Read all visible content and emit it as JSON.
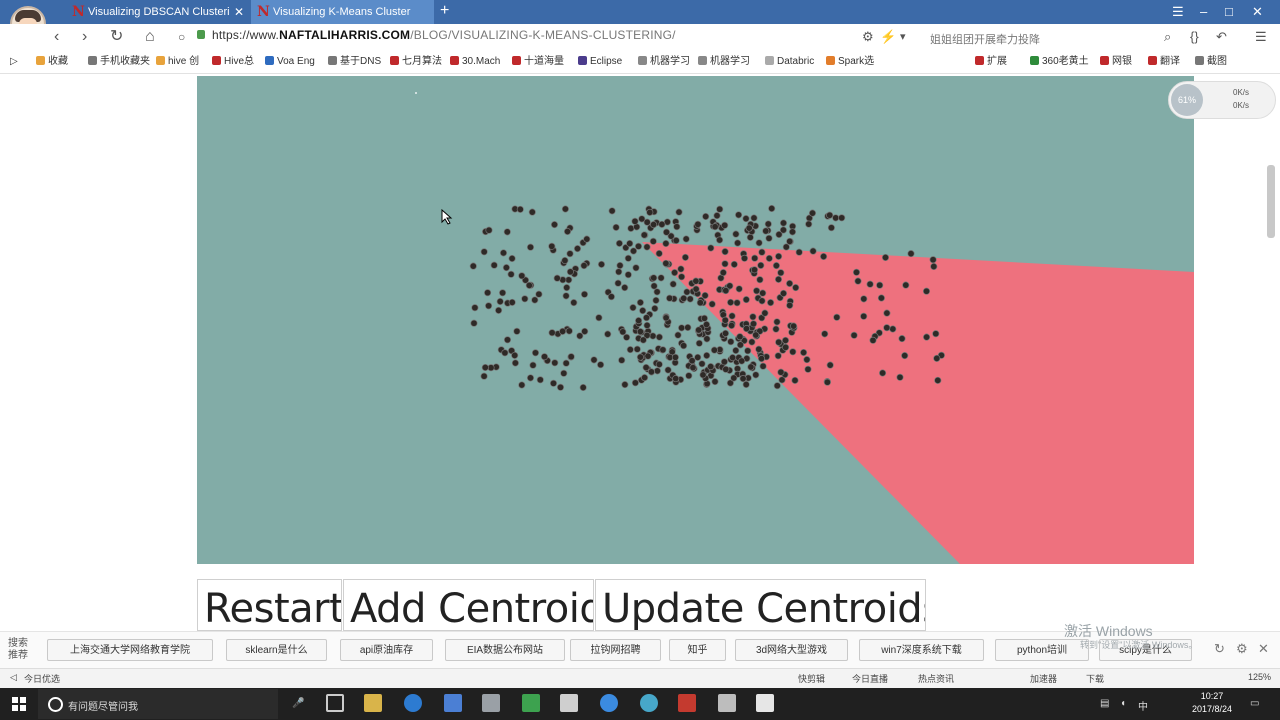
{
  "browser": {
    "tabs": [
      {
        "label": "Visualizing DBSCAN Clusteri",
        "active": false
      },
      {
        "label": "Visualizing K-Means Cluster",
        "active": true
      }
    ],
    "url_scheme": "https://www.",
    "url_domain": "NAFTALIHARRIS.COM",
    "url_path": "/BLOG/VISUALIZING-K-MEANS-CLUSTERING/",
    "news_text": "姐姐组团开展牵力投降",
    "bookmarks": [
      {
        "label": "收藏",
        "color": "#e8a33c"
      },
      {
        "label": "手机收藏夹",
        "color": "#777777"
      },
      {
        "label": "hive 创",
        "color": "#e8a33c"
      },
      {
        "label": "Hive总",
        "color": "#c0292b"
      },
      {
        "label": "Voa Eng",
        "color": "#2e6bbf"
      },
      {
        "label": "基于DNS",
        "color": "#777777"
      },
      {
        "label": "七月算法",
        "color": "#c0292b"
      },
      {
        "label": "30.Mach",
        "color": "#c0292b"
      },
      {
        "label": "十道海量",
        "color": "#c0292b"
      },
      {
        "label": "Eclipse",
        "color": "#4b3c8c"
      },
      {
        "label": "机器学习",
        "color": "#888888"
      },
      {
        "label": "机器学习",
        "color": "#888888"
      },
      {
        "label": "Databric",
        "color": "#aaaaaa"
      },
      {
        "label": "Spark选",
        "color": "#e27d2b"
      },
      {
        "label": "扩展",
        "color": "#c0292b"
      },
      {
        "label": "360老黄土",
        "color": "#2e8b3a"
      },
      {
        "label": "网银",
        "color": "#c0292b"
      },
      {
        "label": "翻译",
        "color": "#c0292b"
      },
      {
        "label": "截图",
        "color": "#777777"
      }
    ],
    "net_widget": {
      "dial": "61%",
      "up": "0K/s",
      "down": "0K/s"
    }
  },
  "page": {
    "buttons": {
      "restart": "Restart",
      "add_centroid": "Add Centroid",
      "update_centroids": "Update Centroids"
    },
    "colors": {
      "cluster_teal": "#82aca7",
      "cluster_pink": "#ee717e",
      "point": "#2e2a27"
    }
  },
  "search_recommend": {
    "label": "搜索推荐",
    "items": [
      "上海交通大学网络教育学院",
      "sklearn是什么",
      "api原油库存",
      "EIA数据公布网站",
      "拉钩网招聘",
      "知乎",
      "3d网络大型游戏",
      "win7深度系统下载",
      "python培训",
      "scipy是什么"
    ],
    "watermark": "激活 Windows",
    "watermark_sub": "转到\"设置\"以激活 Windows。"
  },
  "status_bar": {
    "left": "今日优选",
    "items": [
      "快剪辑",
      "今日直播",
      "热点资讯",
      "加速器",
      "下载",
      "125%"
    ]
  },
  "taskbar": {
    "search_placeholder": "有问题尽管问我",
    "ime": "中",
    "time": "10:27",
    "date": "2017/8/24"
  }
}
